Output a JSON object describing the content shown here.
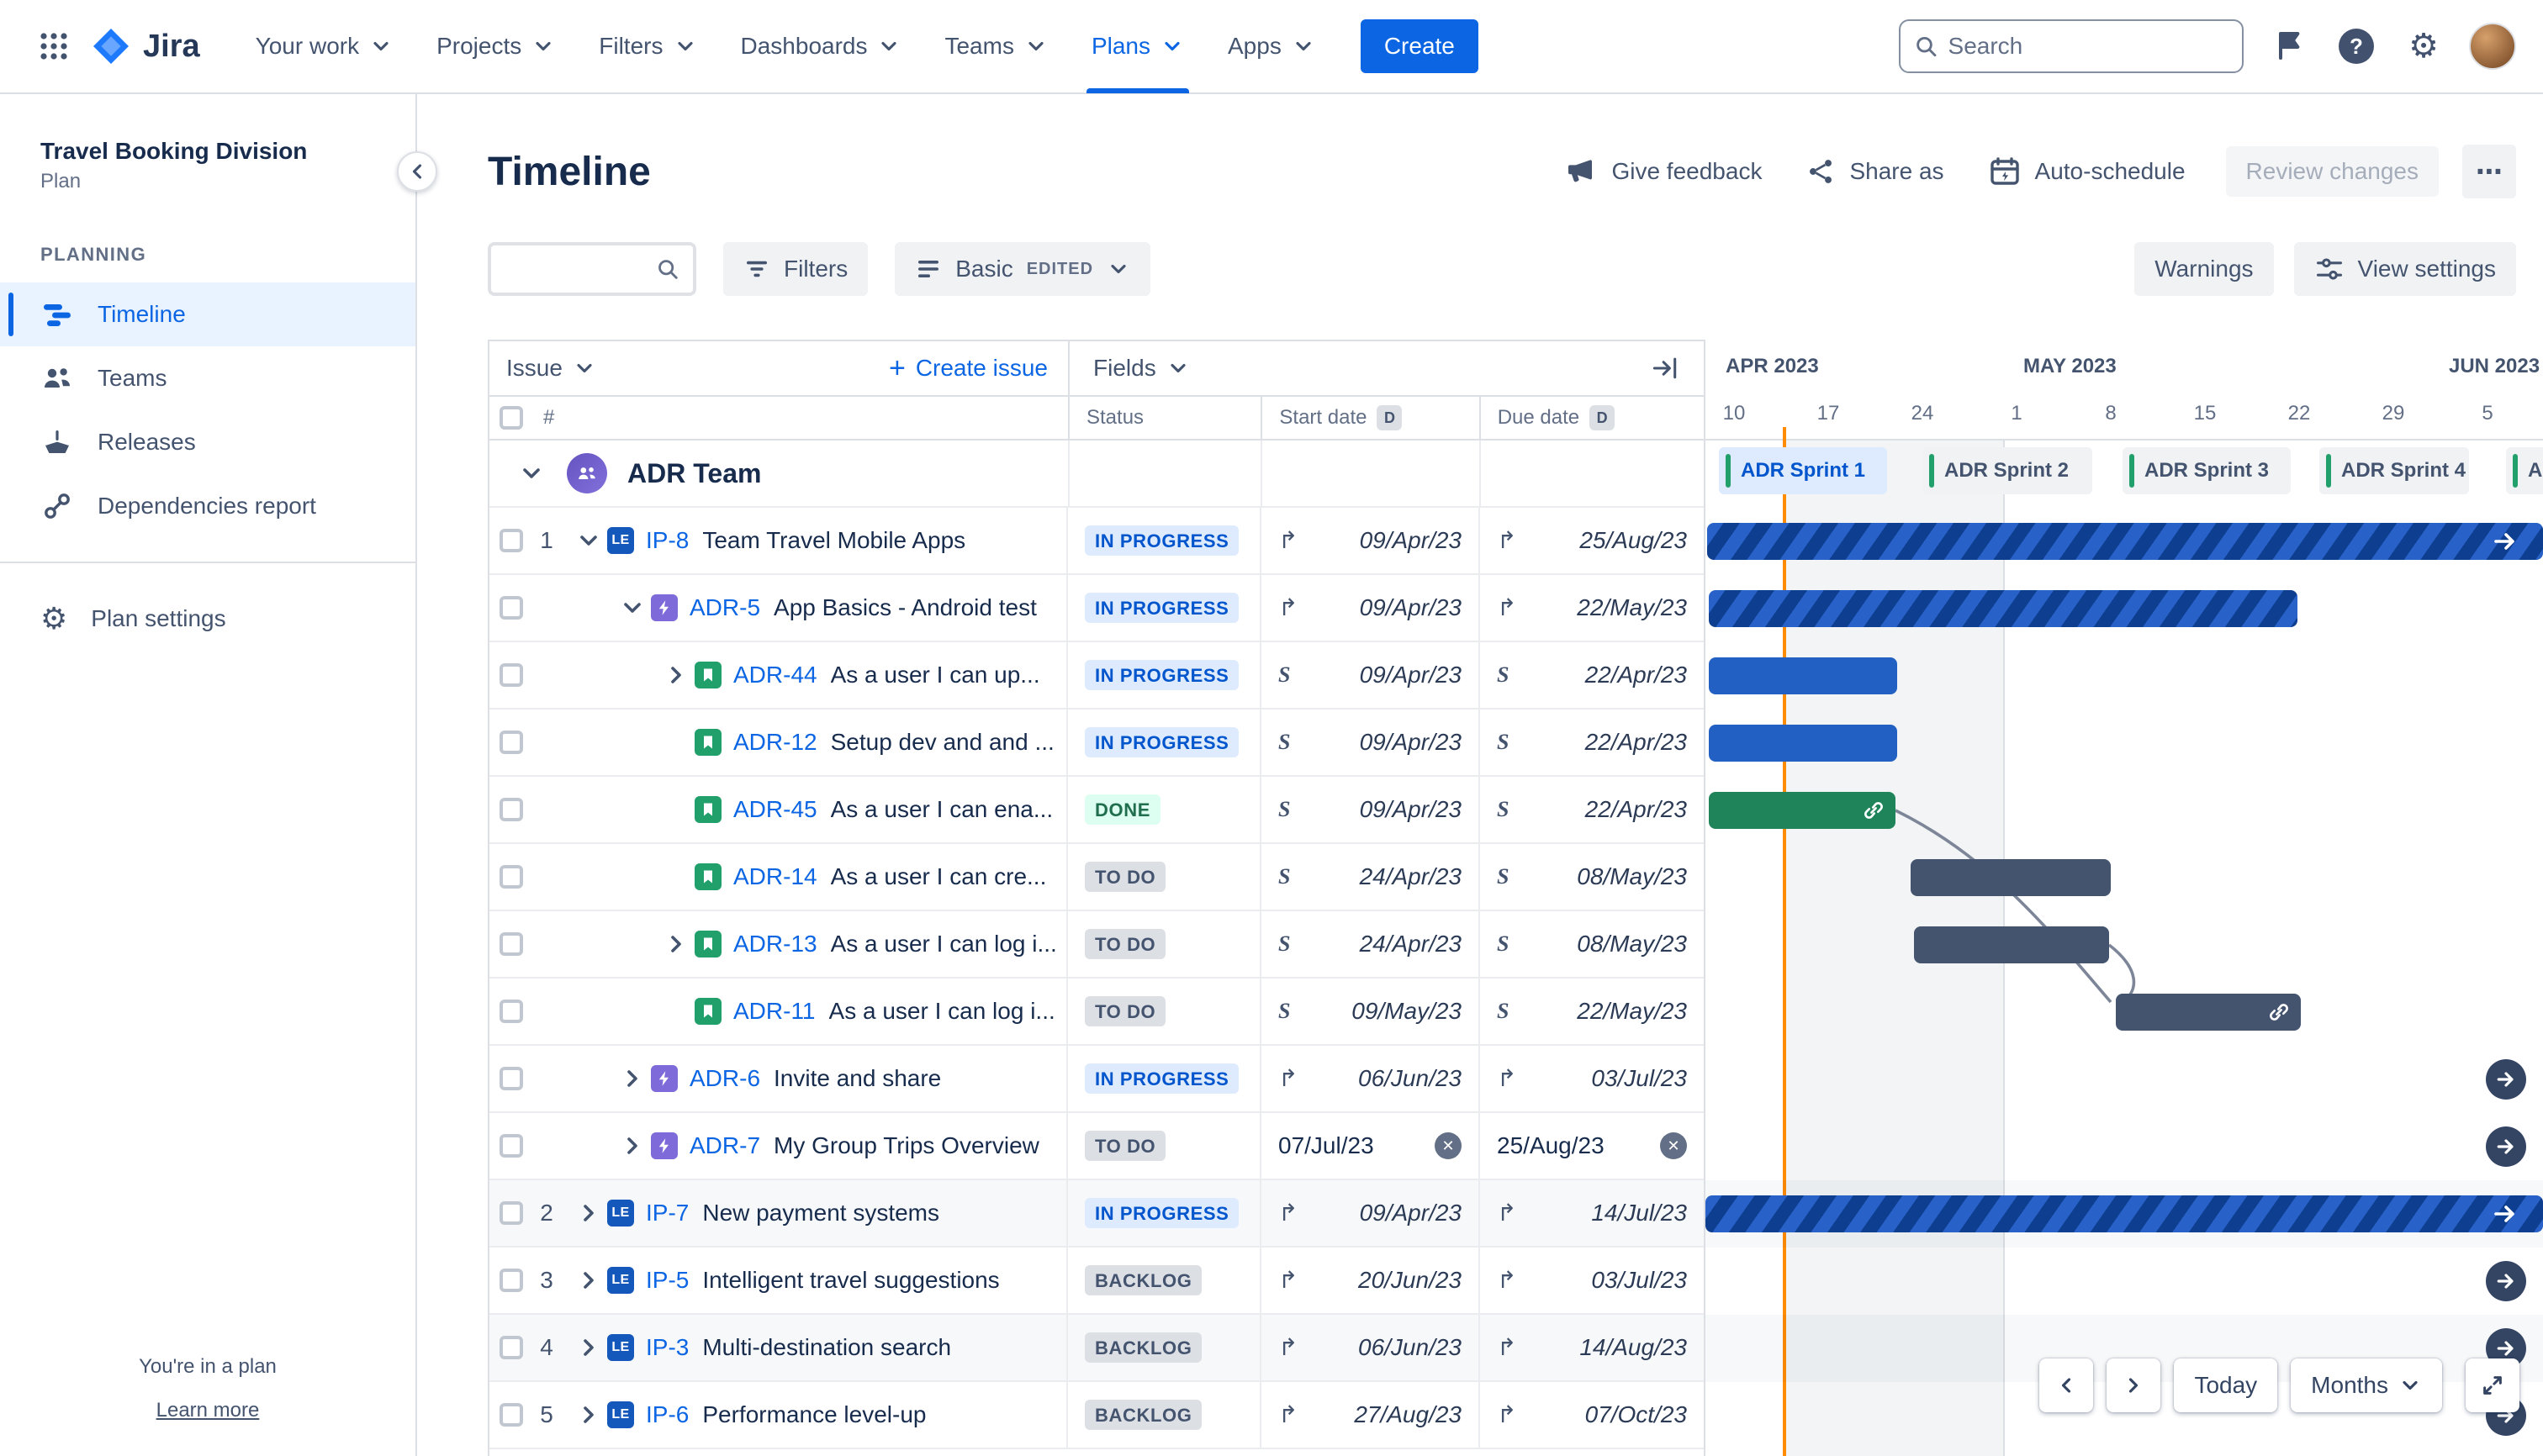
{
  "brand": {
    "name": "Jira"
  },
  "nav": {
    "items": [
      "Your work",
      "Projects",
      "Filters",
      "Dashboards",
      "Teams",
      "Plans",
      "Apps"
    ],
    "active_item": "Plans",
    "create_label": "Create",
    "search_placeholder": "Search"
  },
  "sidebar": {
    "plan_title": "Travel Booking Division",
    "plan_subtitle": "Plan",
    "section_label": "PLANNING",
    "items": [
      {
        "label": "Timeline"
      },
      {
        "label": "Teams"
      },
      {
        "label": "Releases"
      },
      {
        "label": "Dependencies report"
      }
    ],
    "settings_label": "Plan settings",
    "footer_note": "You're in a plan",
    "footer_link": "Learn more"
  },
  "page": {
    "title": "Timeline",
    "actions": {
      "give_feedback": "Give feedback",
      "share_as": "Share as",
      "auto_schedule": "Auto-schedule",
      "review_changes": "Review changes"
    }
  },
  "toolbar": {
    "filters": "Filters",
    "view_mode": "Basic",
    "view_mode_badge": "EDITED",
    "warnings": "Warnings",
    "view_settings": "View settings"
  },
  "grid": {
    "issue": "Issue",
    "create_issue": "Create issue",
    "fields": "Fields",
    "number_header": "#",
    "status": "Status",
    "start_date": "Start date",
    "due_date": "Due date",
    "date_flag": "D"
  },
  "timeline": {
    "months": [
      "APR 2023",
      "MAY 2023",
      "JUN 2023"
    ],
    "ticks": [
      "10",
      "17",
      "24",
      "1",
      "8",
      "15",
      "22",
      "29",
      "5"
    ],
    "sprints": [
      {
        "label": "ADR Sprint 1",
        "current": true
      },
      {
        "label": "ADR Sprint 2"
      },
      {
        "label": "ADR Sprint 3"
      },
      {
        "label": "ADR Sprint 4"
      },
      {
        "label": "AD"
      }
    ],
    "controls": {
      "today": "Today",
      "zoom": "Months"
    }
  },
  "team": {
    "name": "ADR Team"
  },
  "rows": [
    {
      "num": "1",
      "key": "IP-8",
      "type_badge": "LE",
      "summary": "Team Travel Mobile Apps",
      "status": "IN PROGRESS",
      "start": "09/Apr/23",
      "due": "25/Aug/23"
    },
    {
      "key": "ADR-5",
      "summary": "App Basics - Android test",
      "status": "IN PROGRESS",
      "start": "09/Apr/23",
      "due": "22/May/23"
    },
    {
      "key": "ADR-44",
      "summary": "As a user I can up...",
      "status": "IN PROGRESS",
      "start": "09/Apr/23",
      "due": "22/Apr/23"
    },
    {
      "key": "ADR-12",
      "summary": "Setup dev and and ...",
      "status": "IN PROGRESS",
      "start": "09/Apr/23",
      "due": "22/Apr/23"
    },
    {
      "key": "ADR-45",
      "summary": "As a user I can ena...",
      "status": "DONE",
      "start": "09/Apr/23",
      "due": "22/Apr/23"
    },
    {
      "key": "ADR-14",
      "summary": "As a user I can cre...",
      "status": "TO DO",
      "start": "24/Apr/23",
      "due": "08/May/23"
    },
    {
      "key": "ADR-13",
      "summary": "As a user I can log i...",
      "status": "TO DO",
      "start": "24/Apr/23",
      "due": "08/May/23"
    },
    {
      "key": "ADR-11",
      "summary": "As a user I can log i...",
      "status": "TO DO",
      "start": "09/May/23",
      "due": "22/May/23"
    },
    {
      "key": "ADR-6",
      "summary": "Invite and share",
      "status": "IN PROGRESS",
      "start": "06/Jun/23",
      "due": "03/Jul/23"
    },
    {
      "key": "ADR-7",
      "summary": "My Group Trips Overview",
      "status": "TO DO",
      "start": "07/Jul/23",
      "due": "25/Aug/23"
    },
    {
      "num": "2",
      "key": "IP-7",
      "type_badge": "LE",
      "summary": "New payment systems",
      "status": "IN PROGRESS",
      "start": "09/Apr/23",
      "due": "14/Jul/23"
    },
    {
      "num": "3",
      "key": "IP-5",
      "type_badge": "LE",
      "summary": "Intelligent travel suggestions",
      "status": "BACKLOG",
      "start": "20/Jun/23",
      "due": "03/Jul/23"
    },
    {
      "num": "4",
      "key": "IP-3",
      "type_badge": "LE",
      "summary": "Multi-destination search",
      "status": "BACKLOG",
      "start": "06/Jun/23",
      "due": "14/Aug/23"
    },
    {
      "num": "5",
      "key": "IP-6",
      "type_badge": "LE",
      "summary": "Performance level-up",
      "status": "BACKLOG",
      "start": "27/Aug/23",
      "due": "07/Oct/23"
    }
  ],
  "icons": {
    "sprint": "S",
    "rollup": "↱",
    "clear": "✕",
    "help": "?",
    "gear": "⚙",
    "more": "⋯",
    "plus": "+",
    "prev": "‹",
    "next": "›"
  },
  "colors": {
    "brand_blue": "#0C66E4",
    "in_progress_bg": "#DEEBFF",
    "in_progress_text": "#0055CC",
    "done_bg": "#DCFFF1",
    "done_text": "#216E4E",
    "neutral_bg": "#DCDFE4",
    "neutral_text": "#44546F",
    "epic_bar_light": "#2862C8",
    "epic_bar_dark": "#0E3E8F",
    "story_bar_in_progress": "#2360C4",
    "story_bar_done": "#1F845A",
    "story_bar_todo": "#44546F",
    "today_line": "#FF8B00",
    "sprint_accent": "#22A06B"
  }
}
